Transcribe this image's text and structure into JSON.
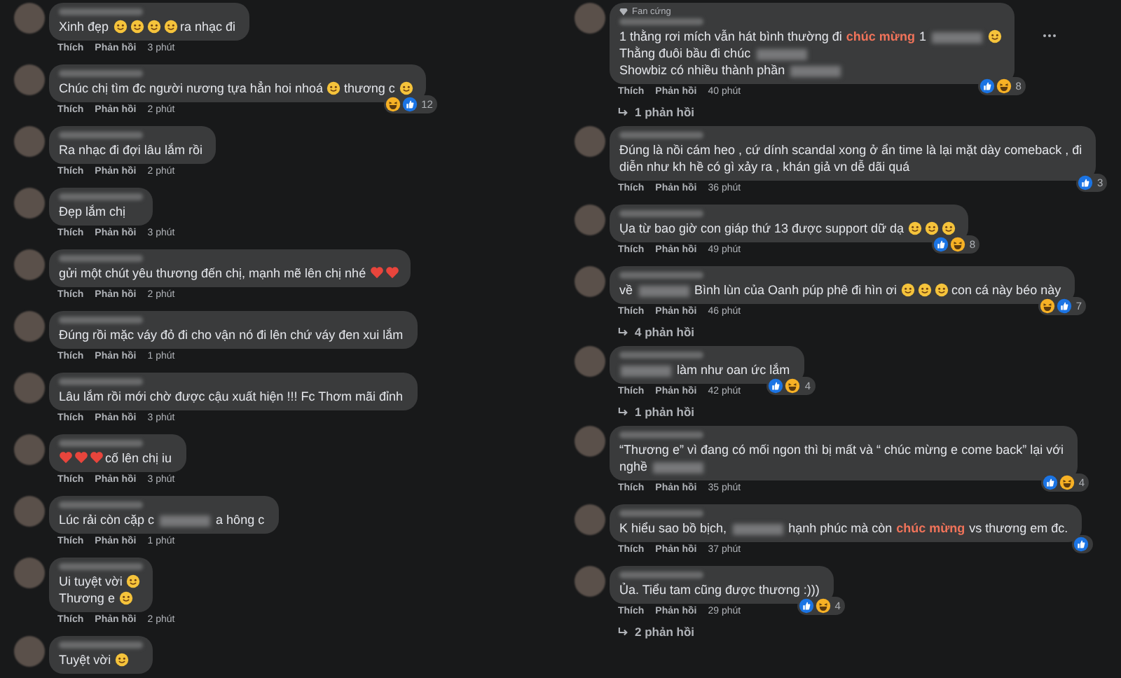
{
  "left_comments": [
    {
      "lines": [
        [
          {
            "kind": "text",
            "text": "Xinh đẹp"
          },
          {
            "kind": "emoji"
          },
          {
            "kind": "emoji"
          },
          {
            "kind": "emoji"
          },
          {
            "kind": "emoji"
          },
          {
            "kind": "text",
            "text": "ra nhạc đi"
          }
        ]
      ],
      "like": "Thích",
      "reply": "Phản hồi",
      "time": "3 phút"
    },
    {
      "lines": [
        [
          {
            "kind": "text",
            "text": "Chúc chị tìm đc người nương tựa hẳn hoi nhoá"
          },
          {
            "kind": "emoji"
          },
          {
            "kind": "text",
            "text": "thương c"
          },
          {
            "kind": "emoji"
          }
        ]
      ],
      "reactions": [
        {
          "kind": "haha"
        },
        {
          "kind": "like"
        }
      ],
      "reaction_count": "12",
      "like": "Thích",
      "reply": "Phản hồi",
      "time": "2 phút"
    },
    {
      "lines": [
        [
          {
            "kind": "text",
            "text": "Ra nhạc đi đợi lâu lắm rồi"
          }
        ]
      ],
      "like": "Thích",
      "reply": "Phản hồi",
      "time": "2 phút"
    },
    {
      "lines": [
        [
          {
            "kind": "text",
            "text": "Đẹp lắm chị"
          }
        ]
      ],
      "like": "Thích",
      "reply": "Phản hồi",
      "time": "3 phút"
    },
    {
      "lines": [
        [
          {
            "kind": "text",
            "text": "gửi một chút yêu thương đến chị, mạnh mẽ lên chị nhé"
          },
          {
            "kind": "heart"
          },
          {
            "kind": "heart"
          }
        ]
      ],
      "like": "Thích",
      "reply": "Phản hồi",
      "time": "2 phút"
    },
    {
      "lines": [
        [
          {
            "kind": "text",
            "text": "Đúng rồi mặc váy đỏ đi cho vận nó đi lên chứ váy đen xui lắm"
          }
        ]
      ],
      "like": "Thích",
      "reply": "Phản hồi",
      "time": "1 phút"
    },
    {
      "lines": [
        [
          {
            "kind": "text",
            "text": "Lâu lắm rồi mới chờ được cậu xuất hiện !!! Fc Thơm mãi đỉnh"
          }
        ]
      ],
      "like": "Thích",
      "reply": "Phản hồi",
      "time": "3 phút"
    },
    {
      "lines": [
        [
          {
            "kind": "heart"
          },
          {
            "kind": "heart"
          },
          {
            "kind": "heart"
          },
          {
            "kind": "text",
            "text": "cố lên chị iu"
          }
        ]
      ],
      "like": "Thích",
      "reply": "Phản hồi",
      "time": "3 phút"
    },
    {
      "lines": [
        [
          {
            "kind": "text",
            "text": "Lúc rải còn cặp c"
          },
          {
            "kind": "redacted"
          },
          {
            "kind": "text",
            "text": "a hông c"
          }
        ]
      ],
      "like": "Thích",
      "reply": "Phản hồi",
      "time": "1 phút"
    },
    {
      "lines": [
        [
          {
            "kind": "text",
            "text": "Ui tuyệt vời"
          },
          {
            "kind": "emoji"
          }
        ],
        [
          {
            "kind": "text",
            "text": "Thương e"
          },
          {
            "kind": "emoji"
          }
        ]
      ],
      "like": "Thích",
      "reply": "Phản hồi",
      "time": "2 phút"
    },
    {
      "lines": [
        [
          {
            "kind": "text",
            "text": "Tuyệt vời"
          },
          {
            "kind": "emoji"
          }
        ]
      ]
    }
  ],
  "right_comments": [
    {
      "badge": "Fan cứng",
      "lines": [
        [
          {
            "kind": "text",
            "text": "1 thằng rơi mích vẫn hát bình thường đi"
          },
          {
            "kind": "highlight",
            "text": "chúc mừng"
          },
          {
            "kind": "text",
            "text": "1"
          },
          {
            "kind": "redacted"
          },
          {
            "kind": "emoji"
          }
        ],
        [
          {
            "kind": "text",
            "text": "Thằng đuôi bầu đi chúc"
          },
          {
            "kind": "redacted"
          }
        ],
        [
          {
            "kind": "text",
            "text": "Showbiz có nhiều thành phần"
          },
          {
            "kind": "redacted"
          }
        ]
      ],
      "more": true,
      "reactions": [
        {
          "kind": "like"
        },
        {
          "kind": "haha"
        }
      ],
      "reaction_count": "8",
      "like": "Thích",
      "reply": "Phản hồi",
      "time": "40 phút",
      "replies": "1 phản hồi"
    },
    {
      "lines": [
        [
          {
            "kind": "text",
            "text": "Đúng là nồi cám heo , cứ dính scandal xong ở ẩn time là lại mặt dày comeback , đi"
          }
        ],
        [
          {
            "kind": "text",
            "text": "diễn như kh hề có gì xảy ra , khán giả vn dễ dãi quá"
          }
        ]
      ],
      "reactions": [
        {
          "kind": "like"
        }
      ],
      "reaction_count": "3",
      "like": "Thích",
      "reply": "Phản hồi",
      "time": "36 phút"
    },
    {
      "lines": [
        [
          {
            "kind": "text",
            "text": "Ụa từ bao giờ con giáp thứ 13 được support dữ dạ"
          },
          {
            "kind": "emoji"
          },
          {
            "kind": "emoji"
          },
          {
            "kind": "emoji"
          }
        ]
      ],
      "reactions": [
        {
          "kind": "like"
        },
        {
          "kind": "haha"
        }
      ],
      "reaction_count": "8",
      "like": "Thích",
      "reply": "Phản hồi",
      "time": "49 phút"
    },
    {
      "lines": [
        [
          {
            "kind": "text",
            "text": "về"
          },
          {
            "kind": "redacted"
          },
          {
            "kind": "text",
            "text": "Bình lùn của Oanh púp phê đi hìn ơi"
          },
          {
            "kind": "emoji"
          },
          {
            "kind": "emoji"
          },
          {
            "kind": "emoji"
          },
          {
            "kind": "text",
            "text": "con cá này béo này"
          }
        ]
      ],
      "reactions": [
        {
          "kind": "haha"
        },
        {
          "kind": "like"
        }
      ],
      "reaction_count": "7",
      "like": "Thích",
      "reply": "Phản hồi",
      "time": "46 phút",
      "replies": "4 phản hồi"
    },
    {
      "lines": [
        [
          {
            "kind": "redacted"
          },
          {
            "kind": "text",
            "text": "làm như oan ức lắm"
          }
        ]
      ],
      "reactions": [
        {
          "kind": "like"
        },
        {
          "kind": "haha"
        }
      ],
      "reaction_count": "4",
      "like": "Thích",
      "reply": "Phản hồi",
      "time": "42 phút",
      "replies": "1 phản hồi"
    },
    {
      "lines": [
        [
          {
            "kind": "text",
            "text": "“Thương e” vì đang có mối ngon thì bị mất và “ chúc mừng e come back” lại với"
          }
        ],
        [
          {
            "kind": "text",
            "text": "nghề"
          },
          {
            "kind": "redacted"
          }
        ]
      ],
      "reactions": [
        {
          "kind": "like"
        },
        {
          "kind": "haha"
        }
      ],
      "reaction_count": "4",
      "like": "Thích",
      "reply": "Phản hồi",
      "time": "35 phút"
    },
    {
      "lines": [
        [
          {
            "kind": "text",
            "text": "K hiểu sao bồ bịch,"
          },
          {
            "kind": "redacted"
          },
          {
            "kind": "text",
            "text": "hạnh phúc mà còn"
          },
          {
            "kind": "highlight",
            "text": "chúc mừng"
          },
          {
            "kind": "text",
            "text": "vs thương em đc."
          }
        ]
      ],
      "reactions": [
        {
          "kind": "like"
        }
      ],
      "like": "Thích",
      "reply": "Phản hồi",
      "time": "37 phút"
    },
    {
      "lines": [
        [
          {
            "kind": "text",
            "text": "Ủa. Tiểu tam cũng được thương :)))"
          }
        ]
      ],
      "reactions": [
        {
          "kind": "like"
        },
        {
          "kind": "haha"
        }
      ],
      "reaction_count": "4",
      "like": "Thích",
      "reply": "Phản hồi",
      "time": "29 phút",
      "replies": "2 phản hồi"
    }
  ]
}
